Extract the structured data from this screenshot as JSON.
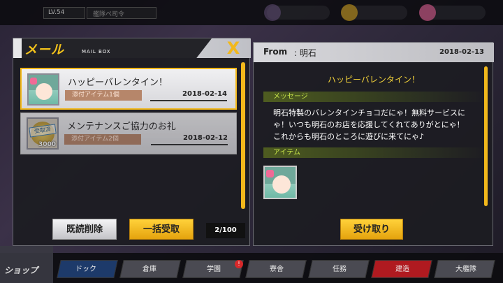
{
  "topbar": {
    "level": "LV.54",
    "player": "艦隊ペ司令"
  },
  "mailbox": {
    "title": "メール",
    "subtitle": "MAIL BOX",
    "close": "X",
    "items": [
      {
        "subject": "ハッピーバレンタイン！",
        "badge": "添付アイテム1個",
        "date": "2018-02-14",
        "selected": true,
        "icon": "character-portrait-icon"
      },
      {
        "subject": "メンテナンスご協力のお礼",
        "badge": "添付アイテム2個",
        "date": "2018-02-12",
        "selected": false,
        "icon": "coin-icon",
        "stamp": "受取済",
        "quantity": "3000"
      }
    ],
    "bulk_delete": "既読削除",
    "bulk_receive": "一括受取",
    "count": "2/100"
  },
  "detail": {
    "from_label": "From",
    "from_name": ": 明石",
    "date": "2018-02-13",
    "subject": "ハッピーバレンタイン！",
    "message_label": "メッセージ",
    "message_lines": [
      "明石特製のバレンタインチョコだにゃ！無料サービスに",
      "ゃ！いつも明石のお店を応援してくれてありがとにゃ！",
      "これからも明石のところに遊びに来てにゃ♪"
    ],
    "item_label": "アイテム",
    "receive": "受け取り"
  },
  "nav": {
    "shop": "ショップ",
    "items": [
      "ドック",
      "倉庫",
      "学園",
      "寮舎",
      "任務",
      "建造",
      "大艦隊"
    ]
  },
  "colors": {
    "accent": "#f2b81b",
    "section": "#c6e34a",
    "active_nav": "#b01a20"
  }
}
